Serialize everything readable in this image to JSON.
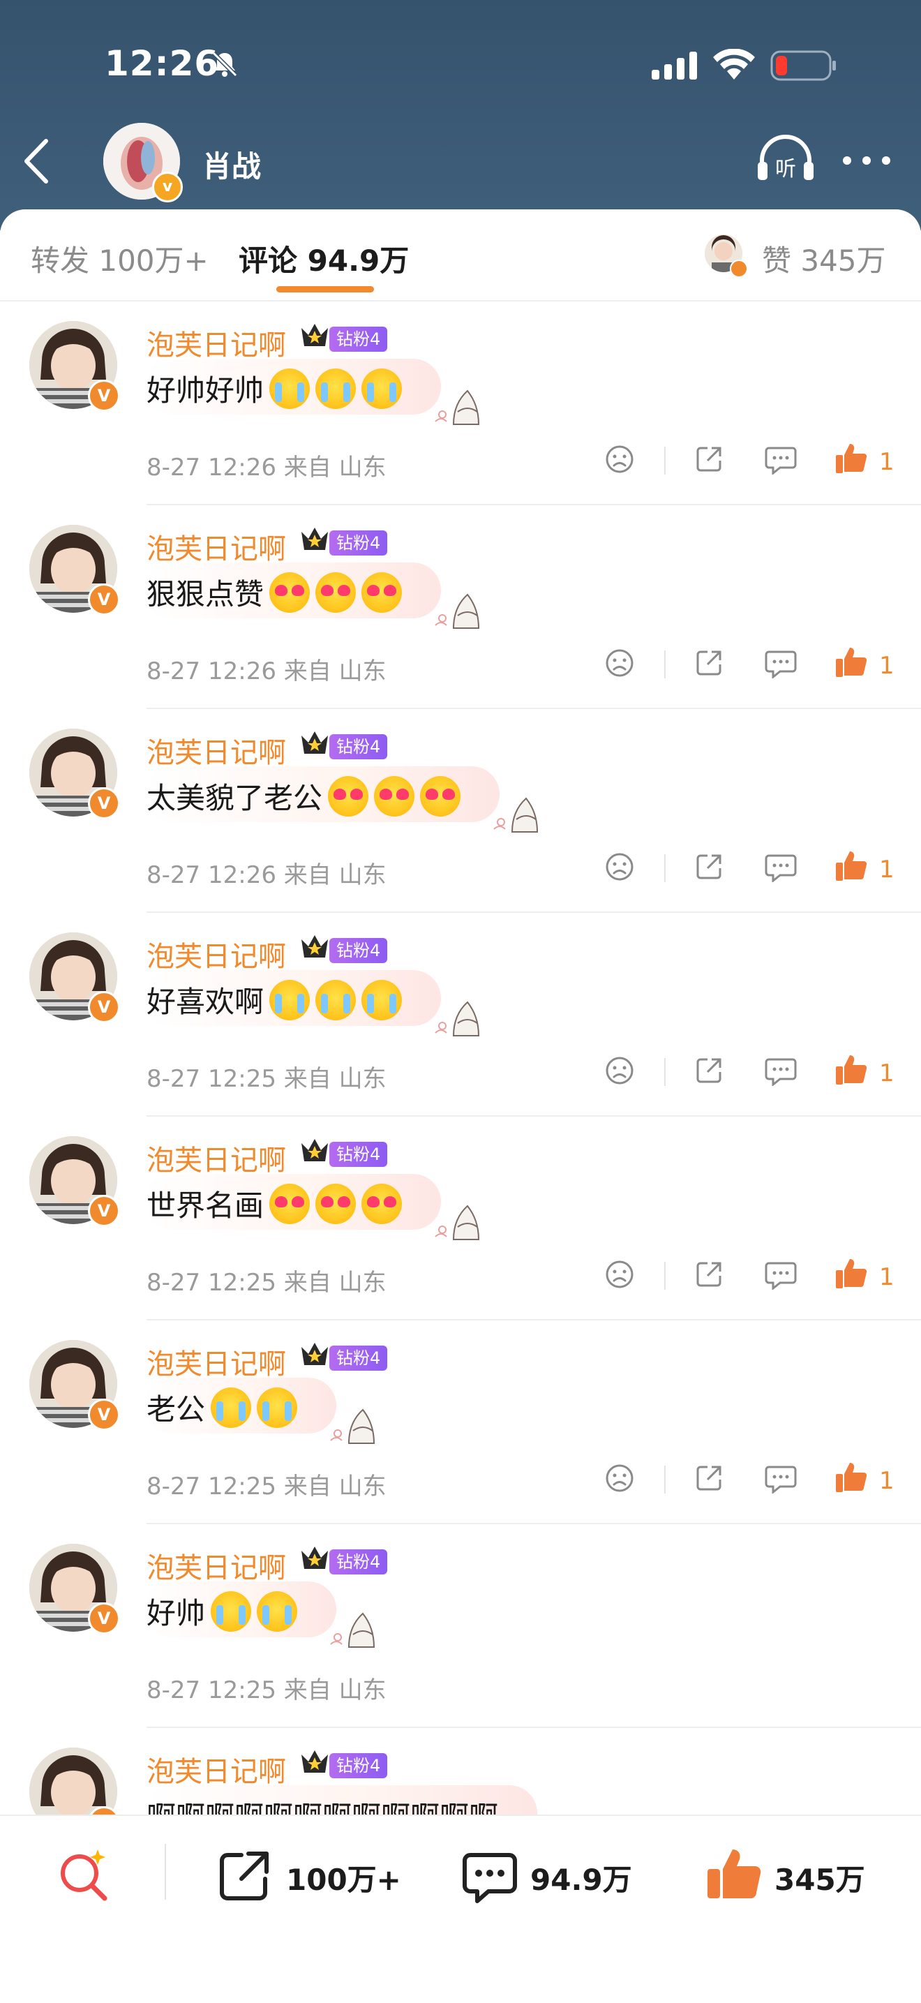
{
  "status_bar": {
    "time": "12:26"
  },
  "profile": {
    "name": "肖战",
    "badge": "v"
  },
  "tabs": {
    "repost": "转发 100万+",
    "comments": "评论 94.9万",
    "likes": "赞 345万"
  },
  "comments": [
    {
      "name": "泡芙日记啊",
      "fan_badge": "钻粉4",
      "text": "好帅好帅",
      "emojis": [
        "cry",
        "cry",
        "cry"
      ],
      "meta": "8-27 12:26  来自 山东",
      "likes": "1"
    },
    {
      "name": "泡芙日记啊",
      "fan_badge": "钻粉4",
      "text": "狠狠点赞",
      "emojis": [
        "heart",
        "heart",
        "heart"
      ],
      "meta": "8-27 12:26  来自 山东",
      "likes": "1"
    },
    {
      "name": "泡芙日记啊",
      "fan_badge": "钻粉4",
      "text": "太美貌了老公",
      "emojis": [
        "heart",
        "heart",
        "heart"
      ],
      "meta": "8-27 12:26  来自 山东",
      "likes": "1"
    },
    {
      "name": "泡芙日记啊",
      "fan_badge": "钻粉4",
      "text": "好喜欢啊",
      "emojis": [
        "cry",
        "cry",
        "cry"
      ],
      "meta": "8-27 12:25  来自 山东",
      "likes": "1"
    },
    {
      "name": "泡芙日记啊",
      "fan_badge": "钻粉4",
      "text": "世界名画",
      "emojis": [
        "heart",
        "heart",
        "heart"
      ],
      "meta": "8-27 12:25  来自 山东",
      "likes": "1"
    },
    {
      "name": "泡芙日记啊",
      "fan_badge": "钻粉4",
      "text": "老公",
      "emojis": [
        "cry",
        "cry"
      ],
      "meta": "8-27 12:25  来自 山东",
      "likes": "1"
    },
    {
      "name": "泡芙日记啊",
      "fan_badge": "钻粉4",
      "text": "好帅",
      "emojis": [
        "cry",
        "cry"
      ],
      "meta": "8-27 12:25  来自 山东",
      "likes": ""
    },
    {
      "name": "泡芙日记啊",
      "fan_badge": "钻粉4",
      "text": "啊啊啊啊啊啊啊啊啊啊啊啊",
      "emojis": [],
      "meta": "",
      "likes": ""
    }
  ],
  "bottom_bar": {
    "repost": "100万+",
    "comments": "94.9万",
    "likes": "345万"
  },
  "colors": {
    "header": "#3a5873",
    "accent": "#f08a2d",
    "fan_badge": "#9a61f1"
  }
}
